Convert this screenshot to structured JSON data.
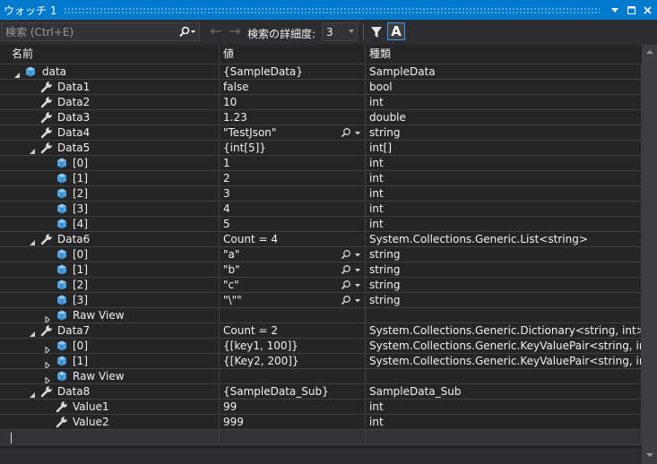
{
  "window": {
    "title": "ウォッチ 1"
  },
  "toolbar": {
    "search_placeholder": "検索 (Ctrl+E)",
    "depth_label": "検索の詳細度:",
    "depth_value": "3",
    "format_button_label": "A"
  },
  "columns": {
    "name": "名前",
    "value": "値",
    "type": "種類"
  },
  "rows": [
    {
      "level": 0,
      "expander": "expanded",
      "icon": "object-icon",
      "name": "data",
      "value": "{SampleData}",
      "type": "SampleData",
      "viz": false
    },
    {
      "level": 1,
      "expander": "none",
      "icon": "wrench-icon",
      "name": "Data1",
      "value": "false",
      "type": "bool",
      "viz": false
    },
    {
      "level": 1,
      "expander": "none",
      "icon": "wrench-icon",
      "name": "Data2",
      "value": "10",
      "type": "int",
      "viz": false
    },
    {
      "level": 1,
      "expander": "none",
      "icon": "wrench-icon",
      "name": "Data3",
      "value": "1.23",
      "type": "double",
      "viz": false
    },
    {
      "level": 1,
      "expander": "none",
      "icon": "wrench-icon",
      "name": "Data4",
      "value": "\"TestJson\"",
      "type": "string",
      "viz": true
    },
    {
      "level": 1,
      "expander": "expanded",
      "icon": "wrench-icon",
      "name": "Data5",
      "value": "{int[5]}",
      "type": "int[]",
      "viz": false
    },
    {
      "level": 2,
      "expander": "none",
      "icon": "object-icon",
      "name": "[0]",
      "value": "1",
      "type": "int",
      "viz": false
    },
    {
      "level": 2,
      "expander": "none",
      "icon": "object-icon",
      "name": "[1]",
      "value": "2",
      "type": "int",
      "viz": false
    },
    {
      "level": 2,
      "expander": "none",
      "icon": "object-icon",
      "name": "[2]",
      "value": "3",
      "type": "int",
      "viz": false
    },
    {
      "level": 2,
      "expander": "none",
      "icon": "object-icon",
      "name": "[3]",
      "value": "4",
      "type": "int",
      "viz": false
    },
    {
      "level": 2,
      "expander": "none",
      "icon": "object-icon",
      "name": "[4]",
      "value": "5",
      "type": "int",
      "viz": false
    },
    {
      "level": 1,
      "expander": "expanded",
      "icon": "wrench-icon",
      "name": "Data6",
      "value": "Count = 4",
      "type": "System.Collections.Generic.List<string>",
      "viz": false
    },
    {
      "level": 2,
      "expander": "none",
      "icon": "object-icon",
      "name": "[0]",
      "value": "\"a\"",
      "type": "string",
      "viz": true
    },
    {
      "level": 2,
      "expander": "none",
      "icon": "object-icon",
      "name": "[1]",
      "value": "\"b\"",
      "type": "string",
      "viz": true
    },
    {
      "level": 2,
      "expander": "none",
      "icon": "object-icon",
      "name": "[2]",
      "value": "\"c\"",
      "type": "string",
      "viz": true
    },
    {
      "level": 2,
      "expander": "none",
      "icon": "object-icon",
      "name": "[3]",
      "value": "\"\\\"\"",
      "type": "string",
      "viz": true
    },
    {
      "level": 2,
      "expander": "collapsed",
      "icon": "object-icon",
      "name": "Raw View",
      "value": "",
      "type": "",
      "viz": false
    },
    {
      "level": 1,
      "expander": "expanded",
      "icon": "wrench-icon",
      "name": "Data7",
      "value": "Count = 2",
      "type": "System.Collections.Generic.Dictionary<string, int>",
      "viz": false
    },
    {
      "level": 2,
      "expander": "collapsed",
      "icon": "object-icon",
      "name": "[0]",
      "value": "{[key1, 100]}",
      "type": "System.Collections.Generic.KeyValuePair<string, int>",
      "viz": false
    },
    {
      "level": 2,
      "expander": "collapsed",
      "icon": "object-icon",
      "name": "[1]",
      "value": "{[Key2, 200]}",
      "type": "System.Collections.Generic.KeyValuePair<string, int>",
      "viz": false
    },
    {
      "level": 2,
      "expander": "collapsed",
      "icon": "object-icon",
      "name": "Raw View",
      "value": "",
      "type": "",
      "viz": false
    },
    {
      "level": 1,
      "expander": "expanded",
      "icon": "wrench-icon",
      "name": "Data8",
      "value": "{SampleData_Sub}",
      "type": "SampleData_Sub",
      "viz": false
    },
    {
      "level": 2,
      "expander": "none",
      "icon": "wrench-icon",
      "name": "Value1",
      "value": "99",
      "type": "int",
      "viz": false
    },
    {
      "level": 2,
      "expander": "none",
      "icon": "wrench-icon",
      "name": "Value2",
      "value": "999",
      "type": "int",
      "viz": false
    }
  ],
  "colors": {
    "accent": "#007acc",
    "object_icon": "#4ba3e3",
    "background": "#252526",
    "grid_line": "#3f3f46"
  }
}
